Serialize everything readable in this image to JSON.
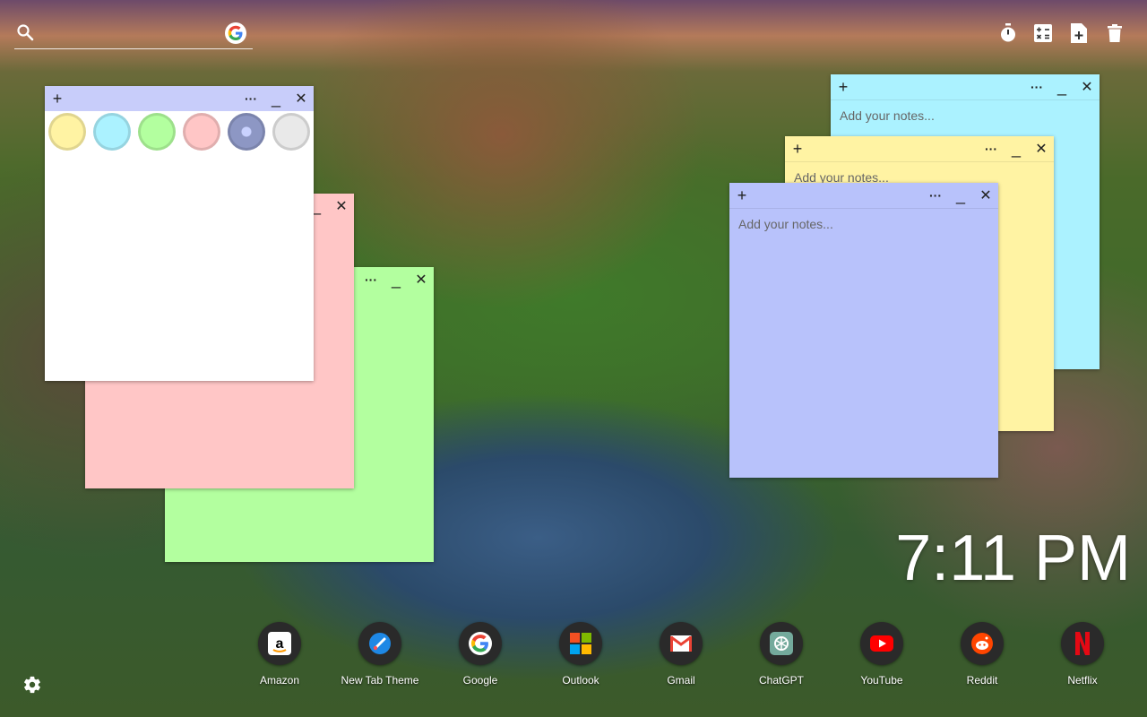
{
  "top": {
    "search_icon": "search-icon",
    "google_icon": "google-icon",
    "right_icons": [
      "timer-icon",
      "calculator-icon",
      "add-note-icon",
      "trash-icon"
    ]
  },
  "notes": {
    "white": {
      "color": "#ffffff",
      "bar": "#c8cdfa"
    },
    "pink": {
      "color": "#ffc6c6",
      "bar": "#ffc6c6"
    },
    "green": {
      "color": "#b3ff9f",
      "bar": "#b3ff9f"
    },
    "cyan": {
      "color": "#abf2ff",
      "bar": "#abf2ff",
      "placeholder": "Add your notes..."
    },
    "yellow": {
      "color": "#fff3a3",
      "bar": "#fff3a3",
      "placeholder": "Add your notes..."
    },
    "blue": {
      "color": "#b8c2fb",
      "bar": "#b8c2fb",
      "placeholder": "Add your notes..."
    }
  },
  "swatches": [
    "#fff3a3",
    "#abf2ff",
    "#b3ff9f",
    "#ffc6c6",
    "#8d97c4",
    "#e9e9e9"
  ],
  "bar": {
    "add": "+",
    "more": "···",
    "minimize": "_",
    "close": "✕"
  },
  "clock": "7:11 PM",
  "dock": [
    {
      "label": "Amazon"
    },
    {
      "label": "New Tab Theme"
    },
    {
      "label": "Google"
    },
    {
      "label": "Outlook"
    },
    {
      "label": "Gmail"
    },
    {
      "label": "ChatGPT"
    },
    {
      "label": "YouTube"
    },
    {
      "label": "Reddit"
    },
    {
      "label": "Netflix"
    }
  ]
}
